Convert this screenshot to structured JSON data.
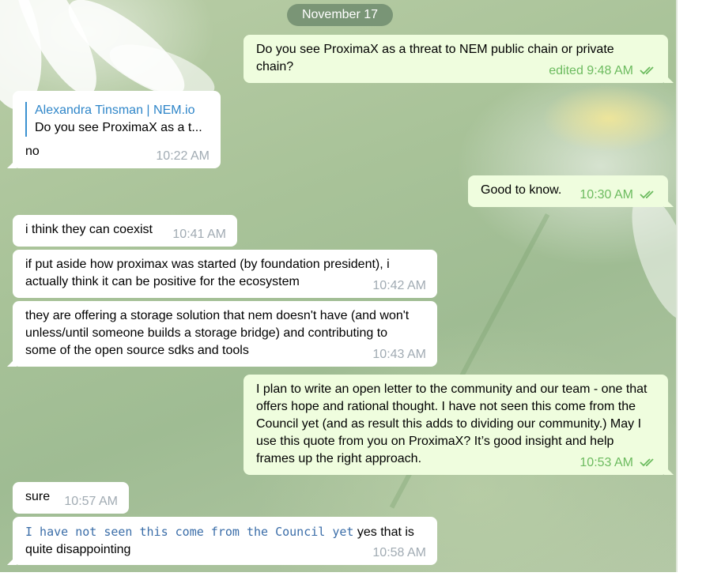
{
  "date_separator": "November 17",
  "messages": [
    {
      "id": "m1",
      "direction": "out",
      "text": "Do you see ProximaX as a threat to NEM public chain or private chain?",
      "time": "edited 9:48 AM"
    },
    {
      "id": "m2",
      "direction": "in",
      "reply_name": "Alexandra Tinsman | NEM.io",
      "reply_text": "Do you see ProximaX as a t...",
      "text": "no",
      "time": "10:22 AM"
    },
    {
      "id": "m3",
      "direction": "out",
      "text": "Good to know.",
      "time": "10:30 AM"
    },
    {
      "id": "m4",
      "direction": "in",
      "text": "i think they can coexist",
      "time": "10:41 AM"
    },
    {
      "id": "m5",
      "direction": "in",
      "text": "if put aside how proximax was started (by foundation president), i actually think it can be positive for the ecosystem",
      "time": "10:42 AM"
    },
    {
      "id": "m6",
      "direction": "in",
      "text": "they are offering a storage solution that nem doesn't have (and won't unless/until someone builds a storage bridge) and contributing to some of the open source sdks and tools",
      "time": "10:43 AM"
    },
    {
      "id": "m7",
      "direction": "out",
      "text": "I plan to write an open letter to the community and our team - one that offers hope and rational thought. I have not seen this come from the Council yet (and as result this adds to dividing our community.) May I use this quote from you on ProximaX? It’s good insight and help frames up the right approach.",
      "time": "10:53 AM"
    },
    {
      "id": "m8",
      "direction": "in",
      "text": "sure",
      "time": "10:57 AM"
    },
    {
      "id": "m9",
      "direction": "in",
      "code": "I have not seen this come from the Council yet",
      "text": "yes that is quite disappointing",
      "time": "10:58 AM"
    }
  ],
  "colors": {
    "incoming": "#ffffff",
    "outgoing": "#effdde",
    "read_check": "#6cbb5f",
    "reply_accent": "#3a91d1"
  }
}
